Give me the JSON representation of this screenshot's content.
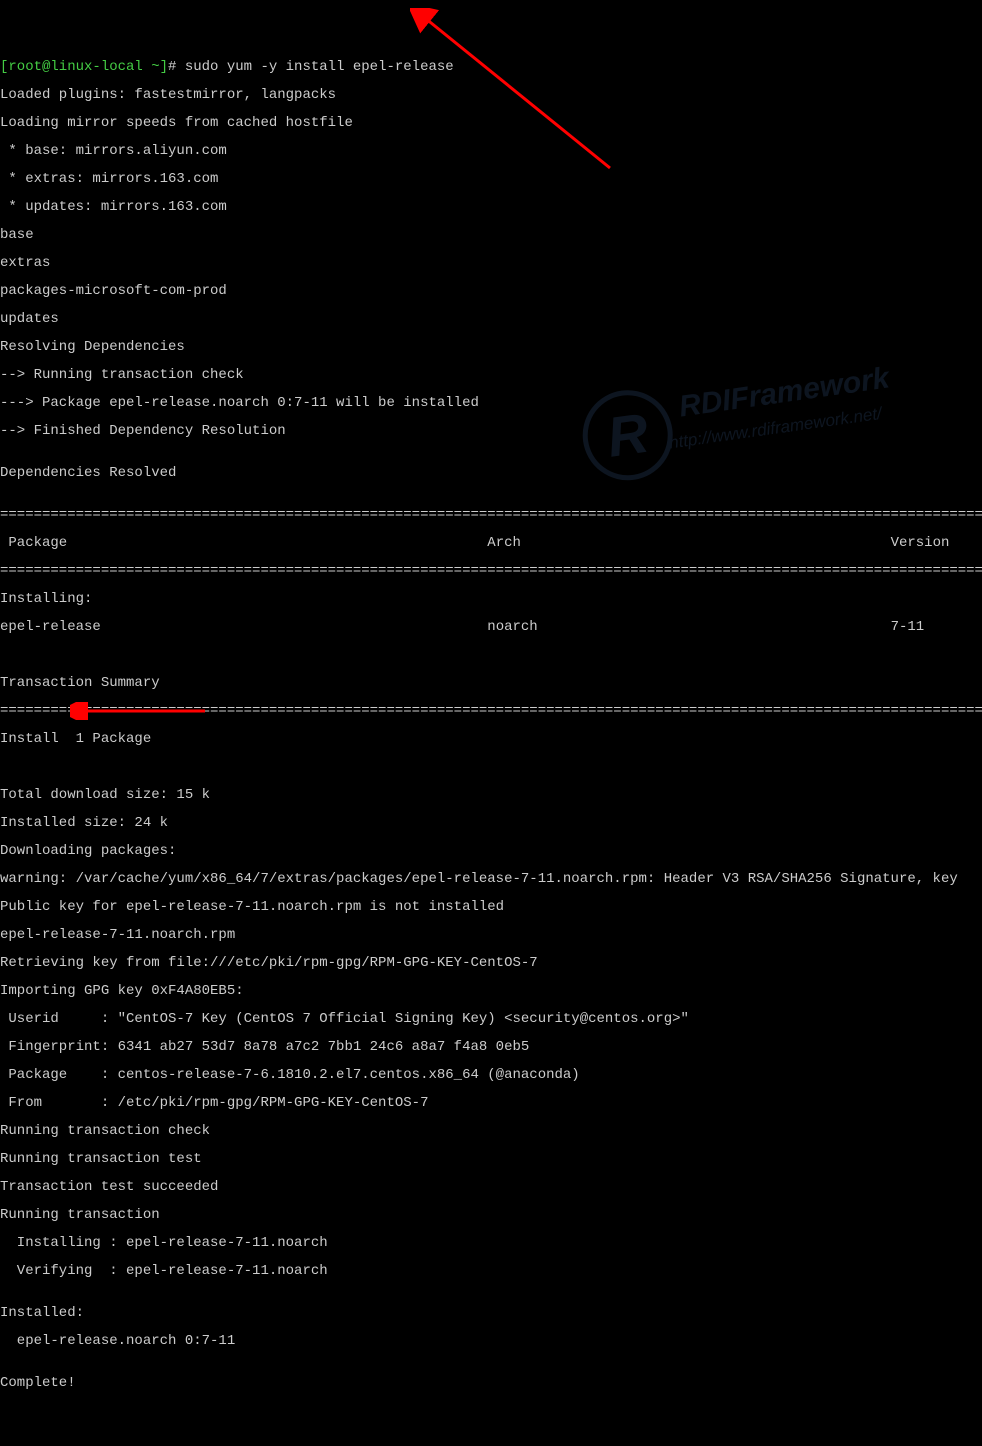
{
  "prompt": {
    "user_host": "[root@linux-local ~]",
    "symbol": "#",
    "command": "sudo yum -y install epel-release"
  },
  "lines": [
    "Loaded plugins: fastestmirror, langpacks",
    "Loading mirror speeds from cached hostfile",
    " * base: mirrors.aliyun.com",
    " * extras: mirrors.163.com",
    " * updates: mirrors.163.com",
    "base",
    "extras",
    "packages-microsoft-com-prod",
    "updates",
    "Resolving Dependencies",
    "--> Running transaction check",
    "---> Package epel-release.noarch 0:7-11 will be installed",
    "--> Finished Dependency Resolution",
    "",
    "Dependencies Resolved",
    ""
  ],
  "separator": "==========================================================================================================================================",
  "table": {
    "header": {
      "package": " Package",
      "arch": "Arch",
      "version": "Version"
    },
    "row": {
      "package": "epel-release",
      "arch": "noarch",
      "version": "7-11"
    },
    "installing_label": "Installing:"
  },
  "summary": {
    "title": "Transaction Summary",
    "install_line": "Install  1 Package",
    "download_size": "Total download size: 15 k",
    "installed_size": "Installed size: 24 k"
  },
  "post_lines": [
    "Downloading packages:",
    "warning: /var/cache/yum/x86_64/7/extras/packages/epel-release-7-11.noarch.rpm: Header V3 RSA/SHA256 Signature, key",
    "Public key for epel-release-7-11.noarch.rpm is not installed",
    "epel-release-7-11.noarch.rpm",
    "Retrieving key from file:///etc/pki/rpm-gpg/RPM-GPG-KEY-CentOS-7",
    "Importing GPG key 0xF4A80EB5:",
    " Userid     : \"CentOS-7 Key (CentOS 7 Official Signing Key) <security@centos.org>\"",
    " Fingerprint: 6341 ab27 53d7 8a78 a7c2 7bb1 24c6 a8a7 f4a8 0eb5",
    " Package    : centos-release-7-6.1810.2.el7.centos.x86_64 (@anaconda)",
    " From       : /etc/pki/rpm-gpg/RPM-GPG-KEY-CentOS-7",
    "Running transaction check",
    "Running transaction test",
    "Transaction test succeeded",
    "Running transaction",
    "  Installing : epel-release-7-11.noarch",
    "  Verifying  : epel-release-7-11.noarch",
    "",
    "Installed:",
    "  epel-release.noarch 0:7-11",
    "",
    "Complete!"
  ],
  "watermark": {
    "brand": "RDIFramework",
    "url": "http://www.rdiframework.net/"
  }
}
